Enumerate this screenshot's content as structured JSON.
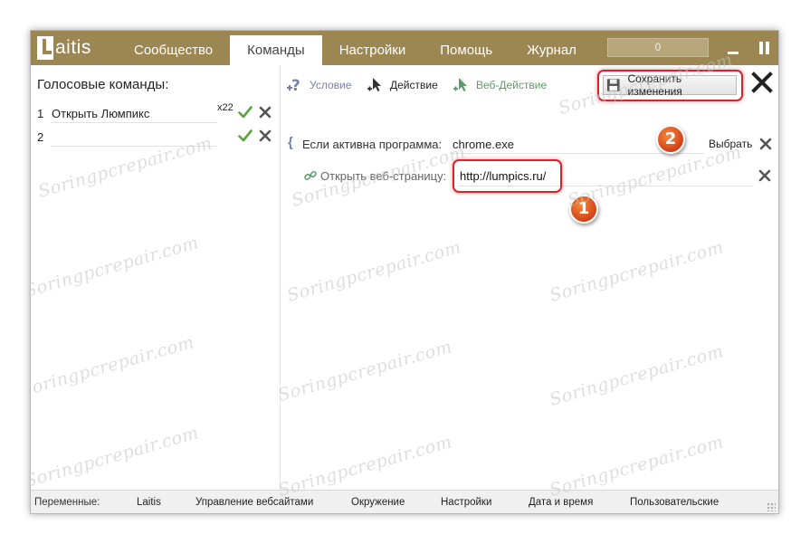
{
  "app": {
    "logo_text": "aitis"
  },
  "tabs": [
    {
      "label": "Сообщество"
    },
    {
      "label": "Команды"
    },
    {
      "label": "Настройки"
    },
    {
      "label": "Помощь"
    },
    {
      "label": "Журнал"
    }
  ],
  "topbar": {
    "counter_value": "0"
  },
  "left": {
    "title": "Голосовые команды:",
    "commands": [
      {
        "num": "1",
        "text": "Открыть Люмпикс",
        "count": "x22"
      },
      {
        "num": "2",
        "text": "",
        "count": ""
      }
    ]
  },
  "toolbar": {
    "condition_label": "Условие",
    "action_label": "Действие",
    "web_action_label": "Веб-Действие",
    "save_label": "Сохранить изменения"
  },
  "condition": {
    "brace": "{",
    "label": "Если активна программа:",
    "value": "chrome.exe",
    "choose_label": "Выбрать"
  },
  "web_action": {
    "label": "Открыть веб-страницу:",
    "value": "http://lumpics.ru/"
  },
  "badges": [
    "1",
    "2"
  ],
  "statusbar": {
    "label": "Переменные:",
    "items": [
      "Laitis",
      "Управление вебсайтами",
      "Окружение",
      "Настройки",
      "Дата и время",
      "Пользовательские"
    ]
  },
  "watermark": "Soringpcrepair.com",
  "colors": {
    "topbar": "#9c8753",
    "highlight": "#d9222a",
    "badge": "#e5602a",
    "check": "#5aa43c"
  }
}
